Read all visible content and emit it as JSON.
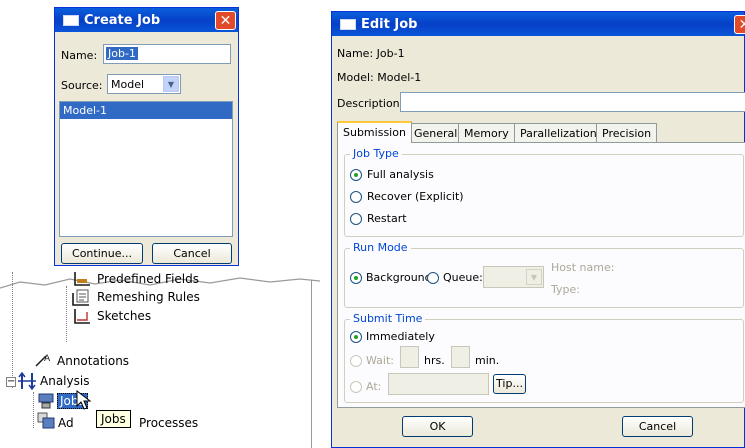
{
  "create_job": {
    "title": "Create Job",
    "close_glyph": "✕",
    "name_label": "Name:",
    "name_value": "Job-1",
    "source_label": "Source:",
    "source_value": "Model",
    "models": [
      "Model-1"
    ],
    "continue_label": "Continue...",
    "cancel_label": "Cancel"
  },
  "tree": {
    "items": [
      "Predefined Fields",
      "Remeshing Rules",
      "Sketches",
      "Annotations",
      "Analysis",
      "Jobs",
      "Adaptivity Processes"
    ],
    "adaptivity_visible_left": "Ad",
    "adaptivity_visible_right": "Processes",
    "tooltip": "Jobs",
    "expander": "−"
  },
  "edit_job": {
    "title": "Edit Job",
    "name_label": "Name:",
    "name_value": "Job-1",
    "model_label": "Model:",
    "model_value": "Model-1",
    "description_label": "Description:",
    "description_value": "",
    "tabs": [
      "Submission",
      "General",
      "Memory",
      "Parallelization",
      "Precision"
    ],
    "job_type": {
      "label": "Job Type",
      "options": [
        "Full analysis",
        "Recover (Explicit)",
        "Restart"
      ],
      "selected": "Full analysis"
    },
    "run_mode": {
      "label": "Run Mode",
      "background": "Background",
      "queue": "Queue:",
      "host_name": "Host name:",
      "type": "Type:"
    },
    "submit_time": {
      "label": "Submit Time",
      "immediately": "Immediately",
      "wait": "Wait:",
      "hrs": "hrs.",
      "min": "min.",
      "at": "At:",
      "tip": "Tip..."
    },
    "ok_label": "OK",
    "cancel_label": "Cancel"
  },
  "colors": {
    "title_blue": "#0a5fdc",
    "selection": "#316ac5",
    "close_red": "#e24a2a"
  }
}
